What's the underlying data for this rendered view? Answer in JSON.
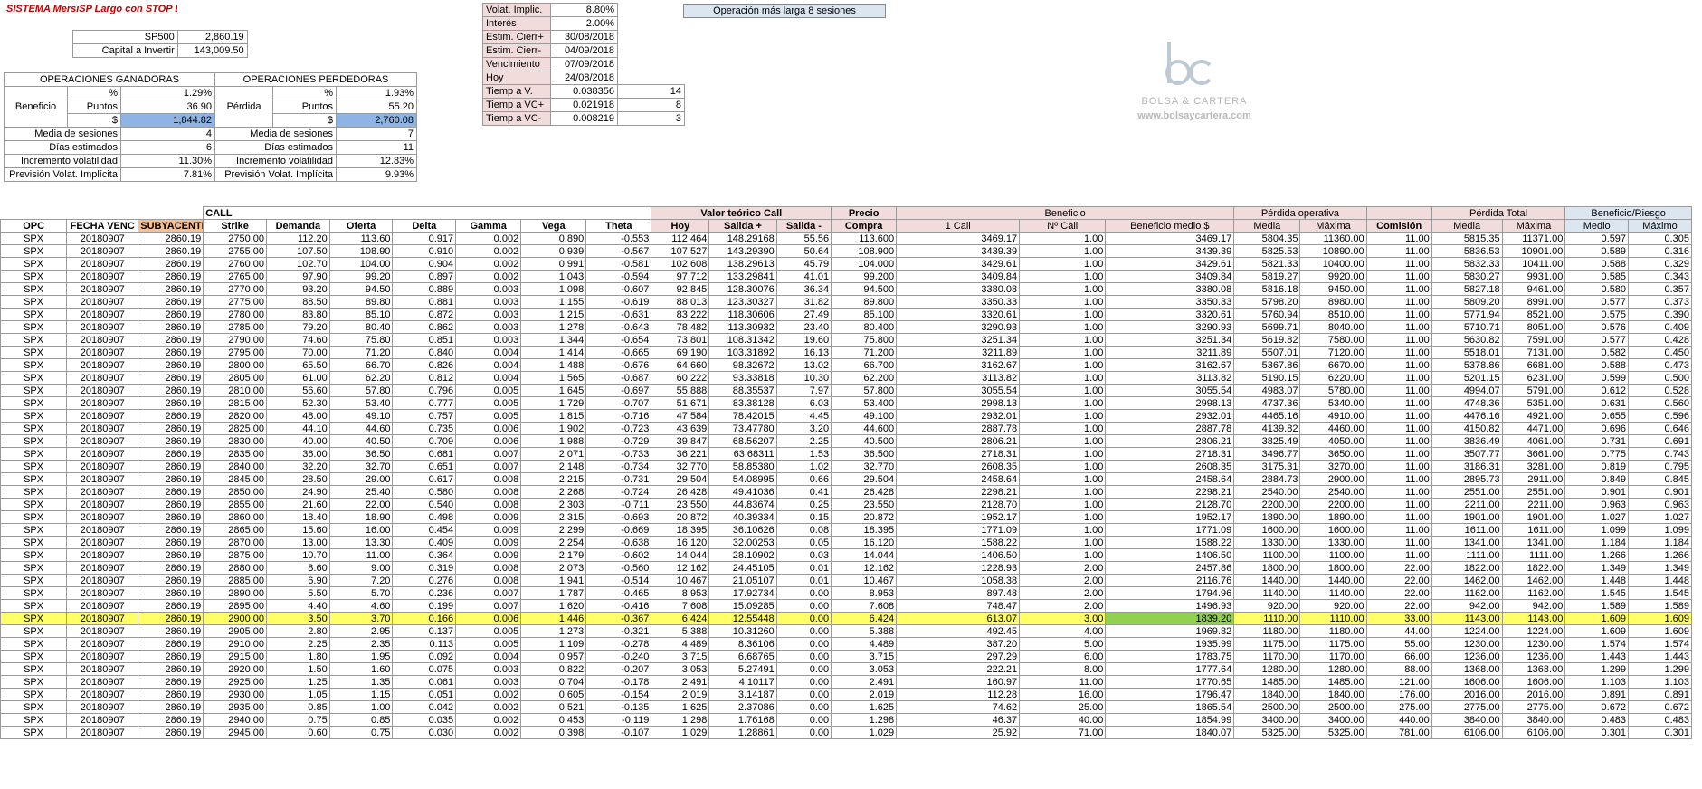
{
  "title": "SISTEMA MersiSP Largo con STOP Bar",
  "sp500": {
    "label": "SP500",
    "value": "2,860.19"
  },
  "capital": {
    "label": "Capital a Invertir",
    "value": "143,009.50"
  },
  "ganadoras": {
    "title": "OPERACIONES GANADORAS",
    "group_label": "Beneficio",
    "pct_label": "%",
    "pct": "1.29%",
    "puntos_label": "Puntos",
    "puntos": "36.90",
    "usd_label": "$",
    "usd": "1,844.82",
    "media_label": "Media de sesiones",
    "media": "4",
    "dias_label": "Días estimados",
    "dias": "6",
    "incr_label": "Incremento volatilidad",
    "incr": "11.30%",
    "prev_label": "Previsión Volat. Implícita",
    "prev": "7.81%"
  },
  "perdedoras": {
    "title": "OPERACIONES PERDEDORAS",
    "group_label": "Pérdida",
    "pct_label": "%",
    "pct": "1.93%",
    "puntos_label": "Puntos",
    "puntos": "55.20",
    "usd_label": "$",
    "usd": "2,760.08",
    "media_label": "Media de sesiones",
    "media": "7",
    "dias_label": "Días estimados",
    "dias": "11",
    "incr_label": "Incremento volatilidad",
    "incr": "12.83%",
    "prev_label": "Previsión Volat. Implícita",
    "prev": "9.93%"
  },
  "params": [
    {
      "label": "Volat. Implic.",
      "value": "8.80%",
      "extra": ""
    },
    {
      "label": "Interés",
      "value": "2.00%",
      "extra": ""
    },
    {
      "label": "Estim. Cierr+",
      "value": "30/08/2018",
      "extra": ""
    },
    {
      "label": "Estim. Cierr-",
      "value": "04/09/2018",
      "extra": ""
    },
    {
      "label": "Vencimiento",
      "value": "07/09/2018",
      "extra": ""
    },
    {
      "label": "Hoy",
      "value": "24/08/2018",
      "extra": ""
    },
    {
      "label": "Tiemp a V.",
      "value": "0.038356",
      "extra": "14"
    },
    {
      "label": "Tiemp a VC+",
      "value": "0.021918",
      "extra": "8"
    },
    {
      "label": "Tiemp a VC-",
      "value": "0.008219",
      "extra": "3"
    }
  ],
  "operacion_larga": "Operación más larga 8 sesiones",
  "logo": {
    "initials": "bc",
    "name": "BOLSA & CARTERA",
    "url": "www.bolsaycartera.com"
  },
  "group_headers": {
    "call": "CALL",
    "valor_teorico": "Valor teórico Call",
    "precio": "Precio",
    "beneficio": "Beneficio",
    "perdida_operativa": "Pérdida operativa",
    "perdida_total": "Pérdida Total",
    "beneficio_riesgo": "Beneficio/Riesgo"
  },
  "columns": [
    "OPC",
    "FECHA VENC",
    "SUBYACENTE",
    "Strike",
    "Demanda",
    "Oferta",
    "Delta",
    "Gamma",
    "Vega",
    "Theta",
    "Hoy",
    "Salida +",
    "Salida -",
    "Compra",
    "1 Call",
    "Nº Call",
    "Beneficio medio $",
    "Media",
    "Máxima",
    "Comisión",
    "Media",
    "Máxima",
    "Medio",
    "Máximo"
  ],
  "rows": [
    [
      "SPX",
      "20180907",
      "2860.19",
      "2750.00",
      "112.20",
      "113.60",
      "0.917",
      "0.002",
      "0.890",
      "-0.553",
      "112.464",
      "148.29168",
      "55.56",
      "113.600",
      "3469.17",
      "1.00",
      "3469.17",
      "5804.35",
      "11360.00",
      "11.00",
      "5815.35",
      "11371.00",
      "0.597",
      "0.305"
    ],
    [
      "SPX",
      "20180907",
      "2860.19",
      "2755.00",
      "107.50",
      "108.90",
      "0.910",
      "0.002",
      "0.939",
      "-0.567",
      "107.527",
      "143.29390",
      "50.64",
      "108.900",
      "3439.39",
      "1.00",
      "3439.39",
      "5825.53",
      "10890.00",
      "11.00",
      "5836.53",
      "10901.00",
      "0.589",
      "0.316"
    ],
    [
      "SPX",
      "20180907",
      "2860.19",
      "2760.00",
      "102.70",
      "104.00",
      "0.904",
      "0.002",
      "0.991",
      "-0.581",
      "102.608",
      "138.29613",
      "45.79",
      "104.000",
      "3429.61",
      "1.00",
      "3429.61",
      "5821.33",
      "10400.00",
      "11.00",
      "5832.33",
      "10411.00",
      "0.588",
      "0.329"
    ],
    [
      "SPX",
      "20180907",
      "2860.19",
      "2765.00",
      "97.90",
      "99.20",
      "0.897",
      "0.002",
      "1.043",
      "-0.594",
      "97.712",
      "133.29841",
      "41.01",
      "99.200",
      "3409.84",
      "1.00",
      "3409.84",
      "5819.27",
      "9920.00",
      "11.00",
      "5830.27",
      "9931.00",
      "0.585",
      "0.343"
    ],
    [
      "SPX",
      "20180907",
      "2860.19",
      "2770.00",
      "93.20",
      "94.50",
      "0.889",
      "0.003",
      "1.098",
      "-0.607",
      "92.845",
      "128.30076",
      "36.34",
      "94.500",
      "3380.08",
      "1.00",
      "3380.08",
      "5816.18",
      "9450.00",
      "11.00",
      "5827.18",
      "9461.00",
      "0.580",
      "0.357"
    ],
    [
      "SPX",
      "20180907",
      "2860.19",
      "2775.00",
      "88.50",
      "89.80",
      "0.881",
      "0.003",
      "1.155",
      "-0.619",
      "88.013",
      "123.30327",
      "31.82",
      "89.800",
      "3350.33",
      "1.00",
      "3350.33",
      "5798.20",
      "8980.00",
      "11.00",
      "5809.20",
      "8991.00",
      "0.577",
      "0.373"
    ],
    [
      "SPX",
      "20180907",
      "2860.19",
      "2780.00",
      "83.80",
      "85.10",
      "0.872",
      "0.003",
      "1.215",
      "-0.631",
      "83.222",
      "118.30606",
      "27.49",
      "85.100",
      "3320.61",
      "1.00",
      "3320.61",
      "5760.94",
      "8510.00",
      "11.00",
      "5771.94",
      "8521.00",
      "0.575",
      "0.390"
    ],
    [
      "SPX",
      "20180907",
      "2860.19",
      "2785.00",
      "79.20",
      "80.40",
      "0.862",
      "0.003",
      "1.278",
      "-0.643",
      "78.482",
      "113.30932",
      "23.40",
      "80.400",
      "3290.93",
      "1.00",
      "3290.93",
      "5699.71",
      "8040.00",
      "11.00",
      "5710.71",
      "8051.00",
      "0.576",
      "0.409"
    ],
    [
      "SPX",
      "20180907",
      "2860.19",
      "2790.00",
      "74.60",
      "75.80",
      "0.851",
      "0.003",
      "1.344",
      "-0.654",
      "73.801",
      "108.31342",
      "19.60",
      "75.800",
      "3251.34",
      "1.00",
      "3251.34",
      "5619.82",
      "7580.00",
      "11.00",
      "5630.82",
      "7591.00",
      "0.577",
      "0.428"
    ],
    [
      "SPX",
      "20180907",
      "2860.19",
      "2795.00",
      "70.00",
      "71.20",
      "0.840",
      "0.004",
      "1.414",
      "-0.665",
      "69.190",
      "103.31892",
      "16.13",
      "71.200",
      "3211.89",
      "1.00",
      "3211.89",
      "5507.01",
      "7120.00",
      "11.00",
      "5518.01",
      "7131.00",
      "0.582",
      "0.450"
    ],
    [
      "SPX",
      "20180907",
      "2860.19",
      "2800.00",
      "65.50",
      "66.70",
      "0.826",
      "0.004",
      "1.488",
      "-0.676",
      "64.660",
      "98.32672",
      "13.02",
      "66.700",
      "3162.67",
      "1.00",
      "3162.67",
      "5367.86",
      "6670.00",
      "11.00",
      "5378.86",
      "6681.00",
      "0.588",
      "0.473"
    ],
    [
      "SPX",
      "20180907",
      "2860.19",
      "2805.00",
      "61.00",
      "62.20",
      "0.812",
      "0.004",
      "1.565",
      "-0.687",
      "60.222",
      "93.33818",
      "10.30",
      "62.200",
      "3113.82",
      "1.00",
      "3113.82",
      "5190.15",
      "6220.00",
      "11.00",
      "5201.15",
      "6231.00",
      "0.599",
      "0.500"
    ],
    [
      "SPX",
      "20180907",
      "2860.19",
      "2810.00",
      "56.60",
      "57.80",
      "0.796",
      "0.005",
      "1.645",
      "-0.697",
      "55.888",
      "88.35537",
      "7.97",
      "57.800",
      "3055.54",
      "1.00",
      "3055.54",
      "4983.07",
      "5780.00",
      "11.00",
      "4994.07",
      "5791.00",
      "0.612",
      "0.528"
    ],
    [
      "SPX",
      "20180907",
      "2860.19",
      "2815.00",
      "52.30",
      "53.40",
      "0.777",
      "0.005",
      "1.729",
      "-0.707",
      "51.671",
      "83.38128",
      "6.03",
      "53.400",
      "2998.13",
      "1.00",
      "2998.13",
      "4737.36",
      "5340.00",
      "11.00",
      "4748.36",
      "5351.00",
      "0.631",
      "0.560"
    ],
    [
      "SPX",
      "20180907",
      "2860.19",
      "2820.00",
      "48.00",
      "49.10",
      "0.757",
      "0.005",
      "1.815",
      "-0.716",
      "47.584",
      "78.42015",
      "4.45",
      "49.100",
      "2932.01",
      "1.00",
      "2932.01",
      "4465.16",
      "4910.00",
      "11.00",
      "4476.16",
      "4921.00",
      "0.655",
      "0.596"
    ],
    [
      "SPX",
      "20180907",
      "2860.19",
      "2825.00",
      "44.10",
      "44.60",
      "0.735",
      "0.006",
      "1.902",
      "-0.723",
      "43.639",
      "73.47780",
      "3.20",
      "44.600",
      "2887.78",
      "1.00",
      "2887.78",
      "4139.82",
      "4460.00",
      "11.00",
      "4150.82",
      "4471.00",
      "0.696",
      "0.646"
    ],
    [
      "SPX",
      "20180907",
      "2860.19",
      "2830.00",
      "40.00",
      "40.50",
      "0.709",
      "0.006",
      "1.988",
      "-0.729",
      "39.847",
      "68.56207",
      "2.25",
      "40.500",
      "2806.21",
      "1.00",
      "2806.21",
      "3825.49",
      "4050.00",
      "11.00",
      "3836.49",
      "4061.00",
      "0.731",
      "0.691"
    ],
    [
      "SPX",
      "20180907",
      "2860.19",
      "2835.00",
      "36.00",
      "36.50",
      "0.681",
      "0.007",
      "2.071",
      "-0.733",
      "36.221",
      "63.68311",
      "1.53",
      "36.500",
      "2718.31",
      "1.00",
      "2718.31",
      "3496.77",
      "3650.00",
      "11.00",
      "3507.77",
      "3661.00",
      "0.775",
      "0.743"
    ],
    [
      "SPX",
      "20180907",
      "2860.19",
      "2840.00",
      "32.20",
      "32.70",
      "0.651",
      "0.007",
      "2.148",
      "-0.734",
      "32.770",
      "58.85380",
      "1.02",
      "32.770",
      "2608.35",
      "1.00",
      "2608.35",
      "3175.31",
      "3270.00",
      "11.00",
      "3186.31",
      "3281.00",
      "0.819",
      "0.795"
    ],
    [
      "SPX",
      "20180907",
      "2860.19",
      "2845.00",
      "28.50",
      "29.00",
      "0.617",
      "0.008",
      "2.215",
      "-0.731",
      "29.504",
      "54.08995",
      "0.66",
      "29.504",
      "2458.64",
      "1.00",
      "2458.64",
      "2884.73",
      "2900.00",
      "11.00",
      "2895.73",
      "2911.00",
      "0.849",
      "0.845"
    ],
    [
      "SPX",
      "20180907",
      "2860.19",
      "2850.00",
      "24.90",
      "25.40",
      "0.580",
      "0.008",
      "2.268",
      "-0.724",
      "26.428",
      "49.41036",
      "0.41",
      "26.428",
      "2298.21",
      "1.00",
      "2298.21",
      "2540.00",
      "2540.00",
      "11.00",
      "2551.00",
      "2551.00",
      "0.901",
      "0.901"
    ],
    [
      "SPX",
      "20180907",
      "2860.19",
      "2855.00",
      "21.60",
      "22.00",
      "0.540",
      "0.008",
      "2.303",
      "-0.711",
      "23.550",
      "44.83674",
      "0.25",
      "23.550",
      "2128.70",
      "1.00",
      "2128.70",
      "2200.00",
      "2200.00",
      "11.00",
      "2211.00",
      "2211.00",
      "0.963",
      "0.963"
    ],
    [
      "SPX",
      "20180907",
      "2860.19",
      "2860.00",
      "18.40",
      "18.90",
      "0.498",
      "0.009",
      "2.315",
      "-0.693",
      "20.872",
      "40.39334",
      "0.15",
      "20.872",
      "1952.17",
      "1.00",
      "1952.17",
      "1890.00",
      "1890.00",
      "11.00",
      "1901.00",
      "1901.00",
      "1.027",
      "1.027"
    ],
    [
      "SPX",
      "20180907",
      "2860.19",
      "2865.00",
      "15.60",
      "16.00",
      "0.454",
      "0.009",
      "2.299",
      "-0.669",
      "18.395",
      "36.10626",
      "0.08",
      "18.395",
      "1771.09",
      "1.00",
      "1771.09",
      "1600.00",
      "1600.00",
      "11.00",
      "1611.00",
      "1611.00",
      "1.099",
      "1.099"
    ],
    [
      "SPX",
      "20180907",
      "2860.19",
      "2870.00",
      "13.00",
      "13.30",
      "0.409",
      "0.009",
      "2.254",
      "-0.638",
      "16.120",
      "32.00253",
      "0.05",
      "16.120",
      "1588.22",
      "1.00",
      "1588.22",
      "1330.00",
      "1330.00",
      "11.00",
      "1341.00",
      "1341.00",
      "1.184",
      "1.184"
    ],
    [
      "SPX",
      "20180907",
      "2860.19",
      "2875.00",
      "10.70",
      "11.00",
      "0.364",
      "0.009",
      "2.179",
      "-0.602",
      "14.044",
      "28.10902",
      "0.03",
      "14.044",
      "1406.50",
      "1.00",
      "1406.50",
      "1100.00",
      "1100.00",
      "11.00",
      "1111.00",
      "1111.00",
      "1.266",
      "1.266"
    ],
    [
      "SPX",
      "20180907",
      "2860.19",
      "2880.00",
      "8.60",
      "9.00",
      "0.319",
      "0.008",
      "2.073",
      "-0.560",
      "12.162",
      "24.45105",
      "0.01",
      "12.162",
      "1228.93",
      "2.00",
      "2457.86",
      "1800.00",
      "1800.00",
      "22.00",
      "1822.00",
      "1822.00",
      "1.349",
      "1.349"
    ],
    [
      "SPX",
      "20180907",
      "2860.19",
      "2885.00",
      "6.90",
      "7.20",
      "0.276",
      "0.008",
      "1.941",
      "-0.514",
      "10.467",
      "21.05107",
      "0.01",
      "10.467",
      "1058.38",
      "2.00",
      "2116.76",
      "1440.00",
      "1440.00",
      "22.00",
      "1462.00",
      "1462.00",
      "1.448",
      "1.448"
    ],
    [
      "SPX",
      "20180907",
      "2860.19",
      "2890.00",
      "5.50",
      "5.70",
      "0.236",
      "0.007",
      "1.787",
      "-0.465",
      "8.953",
      "17.92734",
      "0.00",
      "8.953",
      "897.48",
      "2.00",
      "1794.96",
      "1140.00",
      "1140.00",
      "22.00",
      "1162.00",
      "1162.00",
      "1.545",
      "1.545"
    ],
    [
      "SPX",
      "20180907",
      "2860.19",
      "2895.00",
      "4.40",
      "4.60",
      "0.199",
      "0.007",
      "1.620",
      "-0.416",
      "7.608",
      "15.09285",
      "0.00",
      "7.608",
      "748.47",
      "2.00",
      "1496.93",
      "920.00",
      "920.00",
      "22.00",
      "942.00",
      "942.00",
      "1.589",
      "1.589"
    ],
    [
      "SPX",
      "20180907",
      "2860.19",
      "2900.00",
      "3.50",
      "3.70",
      "0.166",
      "0.006",
      "1.446",
      "-0.367",
      "6.424",
      "12.55448",
      "0.00",
      "6.424",
      "613.07",
      "3.00",
      "1839.20",
      "1110.00",
      "1110.00",
      "33.00",
      "1143.00",
      "1143.00",
      "1.609",
      "1.609"
    ],
    [
      "SPX",
      "20180907",
      "2860.19",
      "2905.00",
      "2.80",
      "2.95",
      "0.137",
      "0.005",
      "1.273",
      "-0.321",
      "5.388",
      "10.31260",
      "0.00",
      "5.388",
      "492.45",
      "4.00",
      "1969.82",
      "1180.00",
      "1180.00",
      "44.00",
      "1224.00",
      "1224.00",
      "1.609",
      "1.609"
    ],
    [
      "SPX",
      "20180907",
      "2860.19",
      "2910.00",
      "2.25",
      "2.35",
      "0.113",
      "0.005",
      "1.109",
      "-0.278",
      "4.489",
      "8.36106",
      "0.00",
      "4.489",
      "387.20",
      "5.00",
      "1935.99",
      "1175.00",
      "1175.00",
      "55.00",
      "1230.00",
      "1230.00",
      "1.574",
      "1.574"
    ],
    [
      "SPX",
      "20180907",
      "2860.19",
      "2915.00",
      "1.80",
      "1.95",
      "0.092",
      "0.004",
      "0.957",
      "-0.240",
      "3.715",
      "6.68765",
      "0.00",
      "3.715",
      "297.29",
      "6.00",
      "1783.75",
      "1170.00",
      "1170.00",
      "66.00",
      "1236.00",
      "1236.00",
      "1.443",
      "1.443"
    ],
    [
      "SPX",
      "20180907",
      "2860.19",
      "2920.00",
      "1.50",
      "1.60",
      "0.075",
      "0.003",
      "0.822",
      "-0.207",
      "3.053",
      "5.27491",
      "0.00",
      "3.053",
      "222.21",
      "8.00",
      "1777.64",
      "1280.00",
      "1280.00",
      "88.00",
      "1368.00",
      "1368.00",
      "1.299",
      "1.299"
    ],
    [
      "SPX",
      "20180907",
      "2860.19",
      "2925.00",
      "1.25",
      "1.35",
      "0.061",
      "0.003",
      "0.704",
      "-0.178",
      "2.491",
      "4.10117",
      "0.00",
      "2.491",
      "160.97",
      "11.00",
      "1770.65",
      "1485.00",
      "1485.00",
      "121.00",
      "1606.00",
      "1606.00",
      "1.103",
      "1.103"
    ],
    [
      "SPX",
      "20180907",
      "2860.19",
      "2930.00",
      "1.05",
      "1.15",
      "0.051",
      "0.002",
      "0.605",
      "-0.154",
      "2.019",
      "3.14187",
      "0.00",
      "2.019",
      "112.28",
      "16.00",
      "1796.47",
      "1840.00",
      "1840.00",
      "176.00",
      "2016.00",
      "2016.00",
      "0.891",
      "0.891"
    ],
    [
      "SPX",
      "20180907",
      "2860.19",
      "2935.00",
      "0.85",
      "1.00",
      "0.042",
      "0.002",
      "0.521",
      "-0.135",
      "1.625",
      "2.37086",
      "0.00",
      "1.625",
      "74.62",
      "25.00",
      "1865.54",
      "2500.00",
      "2500.00",
      "275.00",
      "2775.00",
      "2775.00",
      "0.672",
      "0.672"
    ],
    [
      "SPX",
      "20180907",
      "2860.19",
      "2940.00",
      "0.75",
      "0.85",
      "0.035",
      "0.002",
      "0.453",
      "-0.119",
      "1.298",
      "1.76168",
      "0.00",
      "1.298",
      "46.37",
      "40.00",
      "1854.99",
      "3400.00",
      "3400.00",
      "440.00",
      "3840.00",
      "3840.00",
      "0.483",
      "0.483"
    ],
    [
      "SPX",
      "20180907",
      "2860.19",
      "2945.00",
      "0.60",
      "0.75",
      "0.030",
      "0.002",
      "0.398",
      "-0.107",
      "1.029",
      "1.28861",
      "0.00",
      "1.029",
      "25.92",
      "71.00",
      "1840.07",
      "5325.00",
      "5325.00",
      "781.00",
      "6106.00",
      "6106.00",
      "0.301",
      "0.301"
    ]
  ],
  "highlight_row_index": 30
}
